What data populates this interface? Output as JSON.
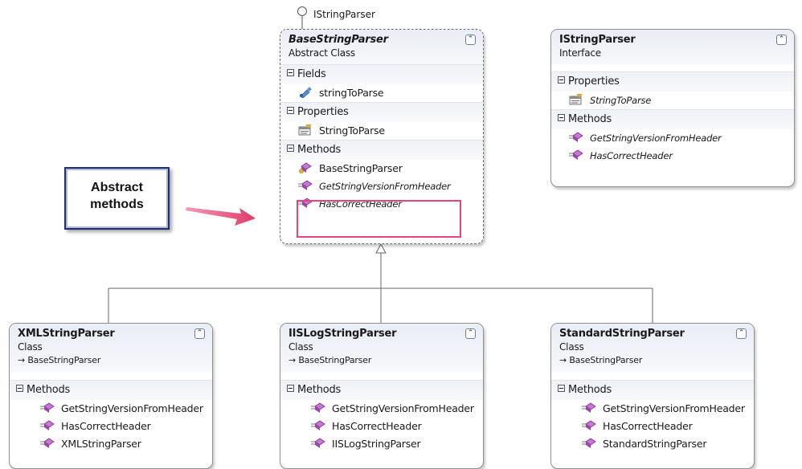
{
  "callout": {
    "line1": "Abstract",
    "line2": "methods"
  },
  "interface_label": "IStringParser",
  "classes": {
    "base": {
      "name": "BaseStringParser",
      "kind": "Abstract Class",
      "compartments": [
        {
          "title": "Fields",
          "members": [
            {
              "name": "stringToParse",
              "icon": "field-icon"
            }
          ]
        },
        {
          "title": "Properties",
          "members": [
            {
              "name": "StringToParse",
              "icon": "property-icon"
            }
          ]
        },
        {
          "title": "Methods",
          "members": [
            {
              "name": "BaseStringParser",
              "icon": "constructor-icon"
            },
            {
              "name": "GetStringVersionFromHeader",
              "icon": "method-icon",
              "abstract": true
            },
            {
              "name": "HasCorrectHeader",
              "icon": "method-icon",
              "abstract": true
            }
          ]
        }
      ]
    },
    "iface": {
      "name": "IStringParser",
      "kind": "Interface",
      "compartments": [
        {
          "title": "Properties",
          "members": [
            {
              "name": "StringToParse",
              "icon": "property-icon"
            }
          ]
        },
        {
          "title": "Methods",
          "members": [
            {
              "name": "GetStringVersionFromHeader",
              "icon": "method-icon"
            },
            {
              "name": "HasCorrectHeader",
              "icon": "method-icon"
            }
          ]
        }
      ]
    },
    "xml": {
      "name": "XMLStringParser",
      "kind": "Class",
      "base": "BaseStringParser",
      "compartments": [
        {
          "title": "Methods",
          "members": [
            {
              "name": "GetStringVersionFromHeader",
              "icon": "method-icon"
            },
            {
              "name": "HasCorrectHeader",
              "icon": "method-icon"
            },
            {
              "name": "XMLStringParser",
              "icon": "method-icon"
            }
          ]
        }
      ]
    },
    "iislog": {
      "name": "IISLogStringParser",
      "kind": "Class",
      "base": "BaseStringParser",
      "compartments": [
        {
          "title": "Methods",
          "members": [
            {
              "name": "GetStringVersionFromHeader",
              "icon": "method-icon"
            },
            {
              "name": "HasCorrectHeader",
              "icon": "method-icon"
            },
            {
              "name": "IISLogStringParser",
              "icon": "method-icon"
            }
          ]
        }
      ]
    },
    "standard": {
      "name": "StandardStringParser",
      "kind": "Class",
      "base": "BaseStringParser",
      "compartments": [
        {
          "title": "Methods",
          "members": [
            {
              "name": "GetStringVersionFromHeader",
              "icon": "method-icon"
            },
            {
              "name": "HasCorrectHeader",
              "icon": "method-icon"
            },
            {
              "name": "StandardStringParser",
              "icon": "method-icon"
            }
          ]
        }
      ]
    }
  },
  "colors": {
    "highlight": "#e5457a",
    "arrow": "#e03a6a",
    "callout_border": "#1f2f6e"
  }
}
